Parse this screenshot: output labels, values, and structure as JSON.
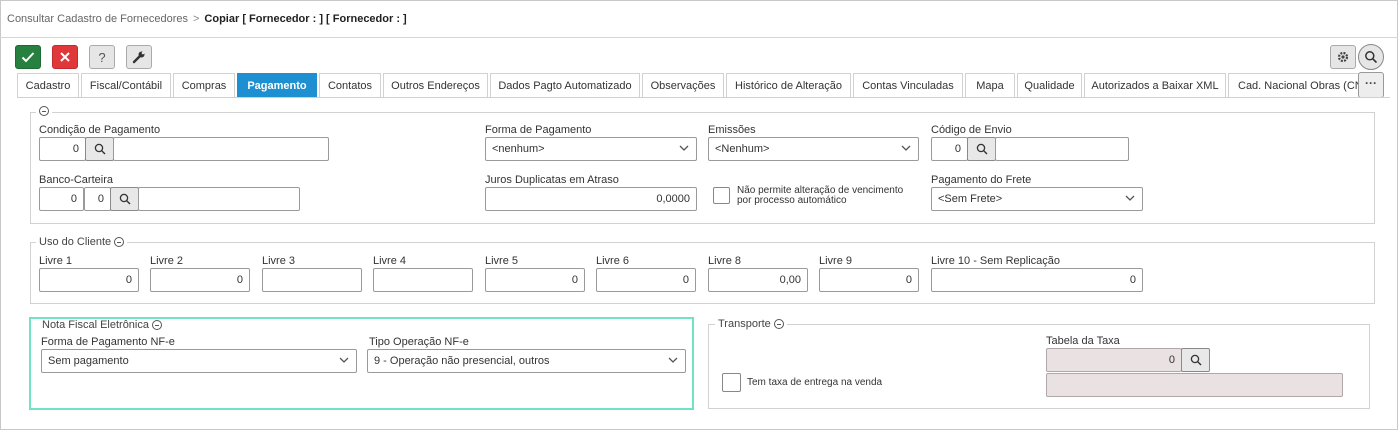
{
  "breadcrumb": {
    "parent": "Consultar Cadastro de Fornecedores",
    "separator": ">",
    "current": "Copiar [ Fornecedor : ] [ Fornecedor : ]"
  },
  "toolbar": {
    "help_label": "?",
    "more_label": "···"
  },
  "tabs": [
    {
      "label": "Cadastro",
      "active": false
    },
    {
      "label": "Fiscal/Contábil",
      "active": false
    },
    {
      "label": "Compras",
      "active": false
    },
    {
      "label": "Pagamento",
      "active": true
    },
    {
      "label": "Contatos",
      "active": false
    },
    {
      "label": "Outros Endereços",
      "active": false
    },
    {
      "label": "Dados Pagto Automatizado",
      "active": false
    },
    {
      "label": "Observações",
      "active": false
    },
    {
      "label": "Histórico de Alteração",
      "active": false
    },
    {
      "label": "Contas Vinculadas",
      "active": false
    },
    {
      "label": "Mapa",
      "active": false
    },
    {
      "label": "Qualidade",
      "active": false
    },
    {
      "label": "Autorizados a Baixar XML",
      "active": false
    },
    {
      "label": "Cad. Nacional Obras (CNO)",
      "active": false
    }
  ],
  "pagamento": {
    "condicao": {
      "label": "Condição de Pagamento",
      "code": "0",
      "description": ""
    },
    "forma": {
      "label": "Forma de Pagamento",
      "value": "<nenhum>"
    },
    "emissoes": {
      "label": "Emissões",
      "value": "<Nenhum>"
    },
    "codigo_envio": {
      "label": "Código de Envio",
      "code": "0",
      "description": ""
    },
    "banco_carteira": {
      "label": "Banco-Carteira",
      "banco": "0",
      "carteira": "0",
      "description": ""
    },
    "juros": {
      "label": "Juros Duplicatas em Atraso",
      "value": "0,0000"
    },
    "nao_permite": {
      "label": "Não permite alteração de vencimento por processo automático",
      "checked": false
    },
    "frete": {
      "label": "Pagamento do Frete",
      "value": "<Sem Frete>"
    }
  },
  "uso_cliente": {
    "title": "Uso do Cliente",
    "fields": [
      {
        "label": "Livre 1",
        "value": "0"
      },
      {
        "label": "Livre 2",
        "value": "0"
      },
      {
        "label": "Livre 3",
        "value": ""
      },
      {
        "label": "Livre 4",
        "value": ""
      },
      {
        "label": "Livre 5",
        "value": "0"
      },
      {
        "label": "Livre 6",
        "value": "0"
      },
      {
        "label": "Livre 8",
        "value": "0,00"
      },
      {
        "label": "Livre 9",
        "value": "0"
      },
      {
        "label": "Livre 10 - Sem Replicação",
        "value": "0"
      }
    ]
  },
  "nfe": {
    "title": "Nota Fiscal Eletrônica",
    "forma_label": "Forma de Pagamento NF-e",
    "forma_value": "Sem pagamento",
    "tipo_label": "Tipo Operação NF-e",
    "tipo_value": "9 - Operação não presencial, outros"
  },
  "transporte": {
    "title": "Transporte",
    "tabela_label": "Tabela da Taxa",
    "tabela_code": "0",
    "tabela_description": "",
    "taxa_label": "Tem taxa de entrega na venda",
    "taxa_checked": false
  },
  "colors": {
    "accent": "#1e8fd1",
    "ok": "#27803f",
    "cancel": "#e0373a",
    "nfe_border": "#6fe3c3",
    "disabled": "#eae2e2"
  },
  "icons": [
    "check-icon",
    "close-icon",
    "help-icon",
    "wrench-icon",
    "gear-icon",
    "search-icon",
    "collapse-icon",
    "chevron-down-icon",
    "more-icon"
  ]
}
